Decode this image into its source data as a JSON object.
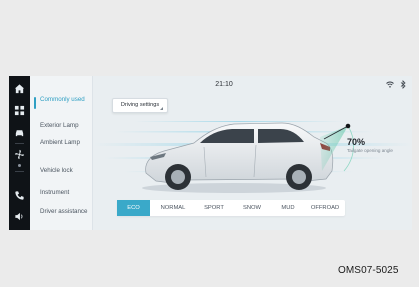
{
  "status_bar": {
    "time": "21:10",
    "icons": [
      "wifi-icon",
      "bluetooth-icon"
    ]
  },
  "rail": {
    "icons": [
      "home-icon",
      "apps-icon",
      "car-icon",
      "fan-icon",
      "phone-icon",
      "volume-icon"
    ]
  },
  "menu": {
    "items": [
      {
        "label": "Commonly used",
        "active": true
      },
      {
        "label": "Exterior Lamp",
        "active": false
      },
      {
        "label": "Ambient Lamp",
        "active": false
      },
      {
        "label": "Vehicle lock",
        "active": false
      },
      {
        "label": "Instrument",
        "active": false
      },
      {
        "label": "Driver assistance",
        "active": false
      }
    ]
  },
  "driving_settings": {
    "label": "Driving settings"
  },
  "tailgate": {
    "value": "70%",
    "label": "Tailgate opening angle",
    "fraction": 0.7
  },
  "modes": {
    "items": [
      "ECO",
      "NORMAL",
      "SPORT",
      "SNOW",
      "MUD",
      "OFFROAD"
    ],
    "selected": "ECO"
  },
  "figure_code": "OMS07-5025",
  "colors": {
    "accent": "#3aa9c9",
    "rail_bg": "#0f1317",
    "screen_bg": "#e9eef1"
  }
}
